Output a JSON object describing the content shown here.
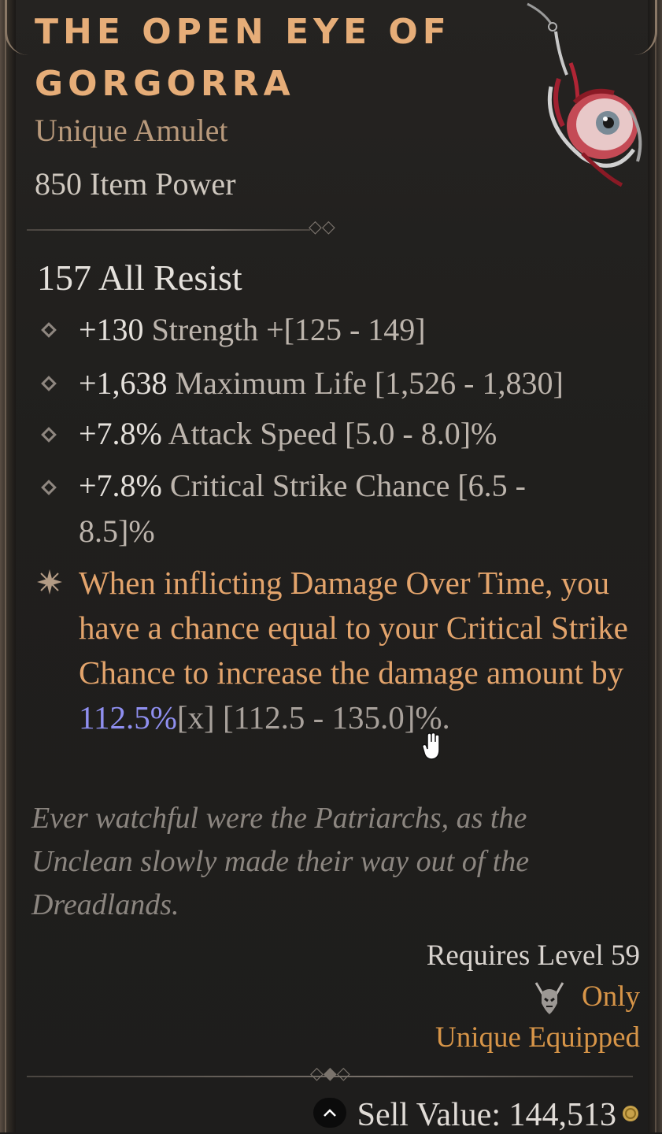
{
  "item": {
    "title": "THE OPEN EYE OF GORGORRA",
    "type": "Unique Amulet",
    "item_power": "850 Item Power",
    "implicit": "157 All Resist"
  },
  "affixes": [
    {
      "value": "+130",
      "text": " Strength +[125 - 149]"
    },
    {
      "value": "+1,638",
      "text": " Maximum Life [1,526 - 1,830]"
    },
    {
      "value": "+7.8%",
      "text": " Attack Speed [5.0 - 8.0]%"
    },
    {
      "value": "+7.8%",
      "text": " Critical Strike Chance [6.5 - 8.5]%"
    }
  ],
  "unique_power": {
    "text_before": "When inflicting Damage Over Time, you have a chance equal to your Critical Strike Chance to increase the damage amount by ",
    "highlight": "112.5%",
    "multiplier": "[x]",
    "range": " [112.5 - 135.0]%."
  },
  "flavor": "Ever watchful were the Patriarchs, as the Unclean slowly made their way out of the Dreadlands.",
  "requirements": {
    "level": "Requires Level 59",
    "class_only": "Only",
    "unique_equipped": "Unique Equipped"
  },
  "sell": {
    "label": "Sell Value: 144,513"
  },
  "colors": {
    "title": "#e6ad78",
    "unique_text": "#e3a46c",
    "highlight": "#8f8ff0",
    "requirement": "#d79548"
  },
  "icons": {
    "amulet": "amulet-eye-icon",
    "class": "necromancer-class-icon",
    "coin": "gold-coin-icon",
    "scroll": "chevron-up-icon"
  }
}
